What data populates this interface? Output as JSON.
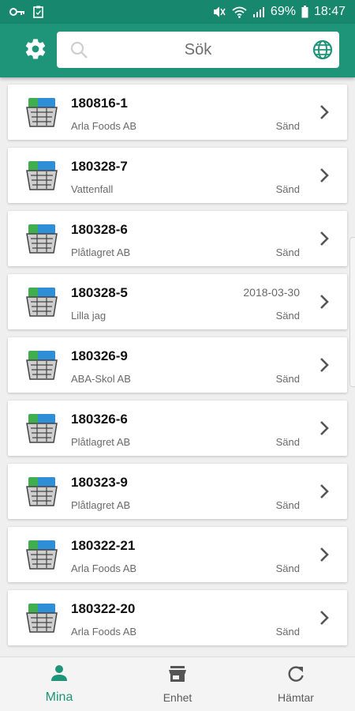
{
  "status_bar": {
    "battery": "69%",
    "time": "18:47"
  },
  "search": {
    "placeholder": "Sök"
  },
  "colors": {
    "primary": "#1e9478",
    "status_bar": "#17876e"
  },
  "items": [
    {
      "id": "180816-1",
      "company": "Arla Foods AB",
      "date": "",
      "status": "Sänd"
    },
    {
      "id": "180328-7",
      "company": "Vattenfall",
      "date": "",
      "status": "Sänd"
    },
    {
      "id": "180328-6",
      "company": "Plåtlagret AB",
      "date": "",
      "status": "Sänd"
    },
    {
      "id": "180328-5",
      "company": "Lilla jag",
      "date": "2018-03-30",
      "status": "Sänd"
    },
    {
      "id": "180326-9",
      "company": "ABA-Skol AB",
      "date": "",
      "status": "Sänd"
    },
    {
      "id": "180326-6",
      "company": "Plåtlagret AB",
      "date": "",
      "status": "Sänd"
    },
    {
      "id": "180323-9",
      "company": "Plåtlagret AB",
      "date": "",
      "status": "Sänd"
    },
    {
      "id": "180322-21",
      "company": "Arla Foods AB",
      "date": "",
      "status": "Sänd"
    },
    {
      "id": "180322-20",
      "company": "Arla Foods AB",
      "date": "",
      "status": "Sänd"
    }
  ],
  "nav": {
    "tabs": [
      {
        "label": "Mina",
        "icon": "person-icon",
        "active": true
      },
      {
        "label": "Enhet",
        "icon": "store-icon",
        "active": false
      },
      {
        "label": "Hämtar",
        "icon": "refresh-icon",
        "active": false
      }
    ]
  }
}
